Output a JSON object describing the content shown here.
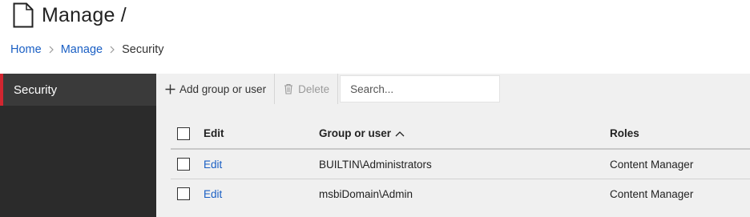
{
  "header": {
    "title": "Manage /",
    "doc_icon": "document-icon"
  },
  "breadcrumb": {
    "items": [
      "Home",
      "Manage",
      "Security"
    ]
  },
  "sidebar": {
    "items": [
      {
        "label": "Security",
        "active": true
      }
    ]
  },
  "toolbar": {
    "add_label": "Add group or user",
    "add_icon": "plus-icon",
    "delete_label": "Delete",
    "delete_icon": "trash-icon",
    "delete_enabled": false,
    "search_placeholder": "Search..."
  },
  "table": {
    "columns": [
      "Edit",
      "Group or user",
      "Roles"
    ],
    "sort_column": "Group or user",
    "sort_direction": "ascending",
    "rows": [
      {
        "edit": "Edit",
        "group": "BUILTIN\\Administrators",
        "roles": "Content Manager",
        "checked": false
      },
      {
        "edit": "Edit",
        "group": "msbiDomain\\Admin",
        "roles": "Content Manager",
        "checked": false
      }
    ]
  },
  "colors": {
    "link": "#1a5fc4",
    "sidebar_bg": "#2b2b2b",
    "sidebar_active_bg": "#3a3a3a",
    "accent": "#d22630",
    "toolbar_bg": "#f0f0f0"
  }
}
